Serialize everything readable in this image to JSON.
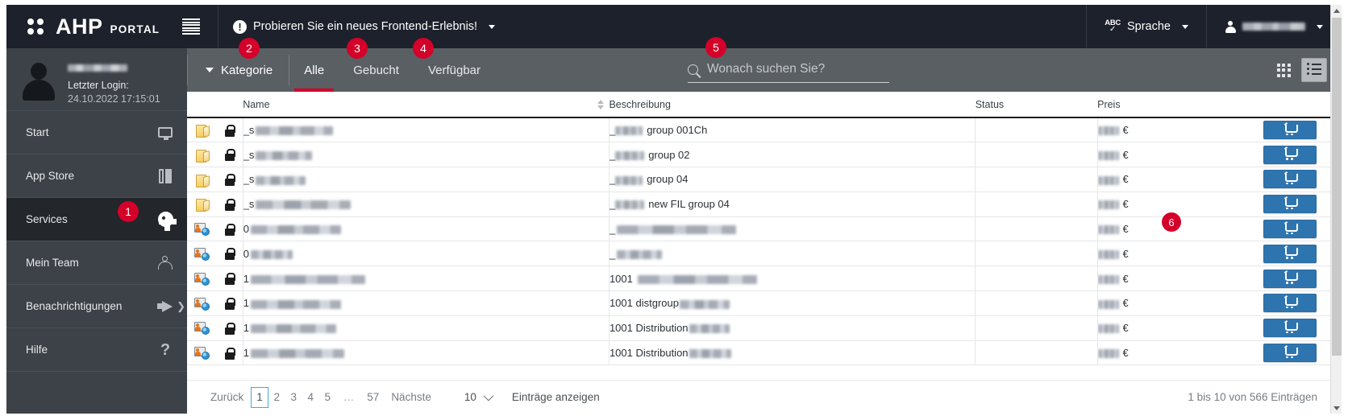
{
  "header": {
    "brand_ahp": "AHP",
    "brand_portal": "PORTAL",
    "banner_text": "Probieren Sie ein neues Frontend-Erlebnis!",
    "language_label": "Sprache",
    "user_name": "",
    "accent_red": "#d4002a",
    "bar_color": "#1c212b"
  },
  "sidebar": {
    "user_name": "",
    "last_login_label": "Letzter Login:",
    "last_login_value": "24.10.2022 17:15:01",
    "items": [
      {
        "label": "Start",
        "icon": "monitor-icon",
        "active": false
      },
      {
        "label": "App Store",
        "icon": "book-icon",
        "active": false
      },
      {
        "label": "Services",
        "icon": "gear-icon",
        "active": true
      },
      {
        "label": "Mein Team",
        "icon": "team-icon",
        "active": false
      },
      {
        "label": "Benachrichtigungen",
        "icon": "megaphone-icon",
        "active": false
      },
      {
        "label": "Hilfe",
        "icon": "question-icon",
        "active": false
      }
    ]
  },
  "toolbar": {
    "category_label": "Kategorie",
    "tabs": [
      {
        "label": "Alle",
        "active": true
      },
      {
        "label": "Gebucht",
        "active": false
      },
      {
        "label": "Verfügbar",
        "active": false
      }
    ],
    "search_placeholder": "Wonach suchen Sie?",
    "search_value": "",
    "view_grid": "grid-view-icon",
    "view_list": "list-view-icon",
    "active_view": "list"
  },
  "table": {
    "columns": [
      "Name",
      "Beschreibung",
      "Status",
      "Preis"
    ],
    "rows": [
      {
        "icon": "folder-icon",
        "locked": true,
        "name": "",
        "desc_prefix": "",
        "desc": "group 001Ch",
        "status": "",
        "price": "€",
        "cart": "cart-icon"
      },
      {
        "icon": "folder-icon",
        "locked": true,
        "name": "",
        "desc_prefix": "",
        "desc": "group 02",
        "status": "",
        "price": "€",
        "cart": "cart-icon"
      },
      {
        "icon": "folder-icon",
        "locked": true,
        "name": "",
        "desc_prefix": "",
        "desc": "group 04",
        "status": "",
        "price": "€",
        "cart": "cart-icon"
      },
      {
        "icon": "folder-icon",
        "locked": true,
        "name": "",
        "desc_prefix": "",
        "desc": "new FIL group 04",
        "status": "",
        "price": "€",
        "cart": "cart-icon"
      },
      {
        "icon": "userglobe-icon",
        "locked": true,
        "name": "0",
        "desc_prefix": "",
        "desc": "",
        "status": "",
        "price": "€",
        "cart": "cart-icon"
      },
      {
        "icon": "userglobe-icon",
        "locked": true,
        "name": "0",
        "desc_prefix": "",
        "desc": "",
        "status": "",
        "price": "€",
        "cart": "cart-icon"
      },
      {
        "icon": "userglobe-icon",
        "locked": true,
        "name": "1",
        "desc_prefix": "1001",
        "desc": "",
        "status": "",
        "price": "€",
        "cart": "cart-icon"
      },
      {
        "icon": "userglobe-icon",
        "locked": true,
        "name": "1",
        "desc_prefix": "1001",
        "desc": "distgroup",
        "status": "",
        "price": "€",
        "cart": "cart-icon"
      },
      {
        "icon": "userglobe-icon",
        "locked": true,
        "name": "1",
        "desc_prefix": "1001",
        "desc": "Distribution",
        "status": "",
        "price": "€",
        "cart": "cart-icon"
      },
      {
        "icon": "userglobe-icon",
        "locked": true,
        "name": "1",
        "desc_prefix": "1001",
        "desc": "Distribution",
        "status": "",
        "price": "€",
        "cart": "cart-icon"
      }
    ]
  },
  "pagination": {
    "prev_label": "Zurück",
    "pages": [
      "1",
      "2",
      "3",
      "4",
      "5",
      "…",
      "57"
    ],
    "current_page": "1",
    "next_label": "Nächste",
    "page_size": "10",
    "page_size_label": "Einträge anzeigen",
    "entries_info": "1 bis 10 von 566 Einträgen"
  },
  "annotations": {
    "b1": "1",
    "b2": "2",
    "b3": "3",
    "b4": "4",
    "b5": "5",
    "b6": "6"
  }
}
